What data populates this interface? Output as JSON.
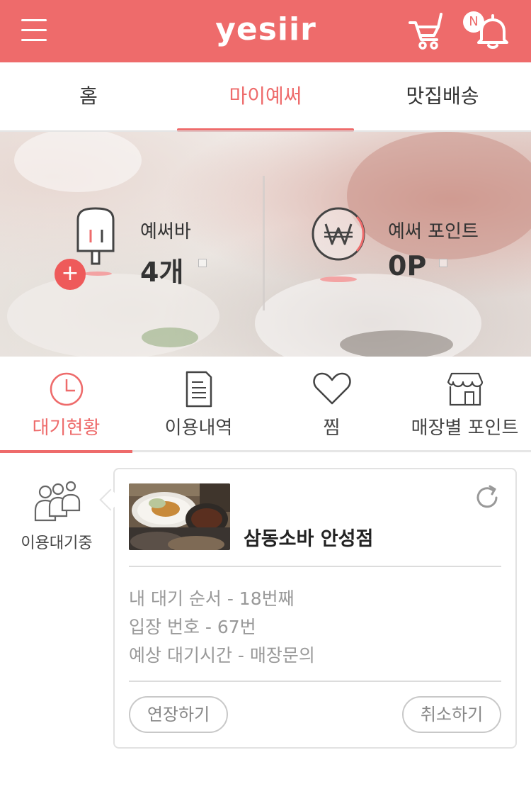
{
  "header": {
    "logo": "yesiir",
    "notification_badge": "N",
    "icons": {
      "menu": "hamburger-icon",
      "cart": "cart-icon",
      "bell": "bell-icon"
    },
    "colors": {
      "brand": "#ee6b6b",
      "text": "#333333"
    }
  },
  "tabs": [
    {
      "label": "홈",
      "active": false
    },
    {
      "label": "마이예써",
      "active": true
    },
    {
      "label": "맛집배송",
      "active": false
    }
  ],
  "banner": {
    "bar": {
      "label": "예써바",
      "value": "4개",
      "icon": "popsicle-icon"
    },
    "point": {
      "label": "예써 포인트",
      "value": "0P",
      "icon": "won-coin-icon"
    },
    "plus": "+"
  },
  "submenu": [
    {
      "label": "대기현황",
      "icon": "clock-icon",
      "active": true
    },
    {
      "label": "이용내역",
      "icon": "document-icon",
      "active": false
    },
    {
      "label": "찜",
      "icon": "heart-icon",
      "active": false
    },
    {
      "label": "매장별 포인트",
      "icon": "store-icon",
      "active": false
    }
  ],
  "waiting": {
    "side_label": "이용대기중",
    "store_name": "삼동소바 안성점",
    "lines": [
      "내 대기 순서 - 18번째",
      "입장 번호 - 67번",
      "예상 대기시간 - 매장문의"
    ],
    "extend_button": "연장하기",
    "cancel_button": "취소하기"
  }
}
